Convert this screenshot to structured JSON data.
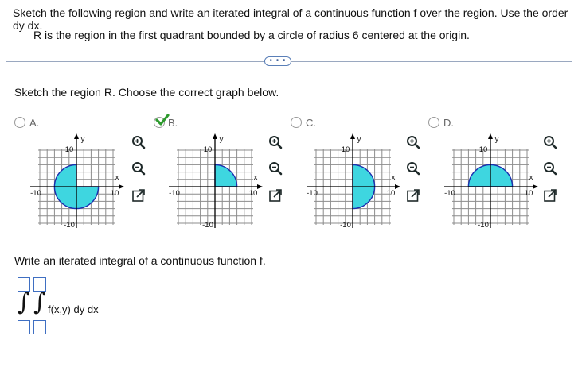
{
  "question": {
    "title": "Sketch the following region and write an iterated integral of a continuous function f over the region. Use the order dy dx.",
    "description": "R is the region in the first quadrant bounded by a circle of radius 6 centered at the origin.",
    "more_label": "• • •"
  },
  "part1": {
    "prompt": "Sketch the region R. Choose the correct graph below.",
    "selected_option": "B",
    "options": [
      {
        "letter": "A.",
        "region": "circle-with-quadrant-removed",
        "axis": {
          "y_label": "y",
          "x_label": "x",
          "ticks": [
            "10",
            "-10",
            "10",
            "-10"
          ]
        }
      },
      {
        "letter": "B.",
        "region": "first-quadrant-quarter-disk",
        "axis": {
          "y_label": "y",
          "x_label": "x",
          "ticks": [
            "10",
            "-10",
            "10",
            "-10"
          ]
        }
      },
      {
        "letter": "C.",
        "region": "right-half-disk",
        "axis": {
          "y_label": "y",
          "x_label": "x",
          "ticks": [
            "10",
            "-10",
            "10",
            "-10"
          ]
        }
      },
      {
        "letter": "D.",
        "region": "upper-half-disk",
        "axis": {
          "y_label": "y",
          "x_label": "x",
          "ticks": [
            "10",
            "-10",
            "10",
            "-10"
          ]
        }
      }
    ]
  },
  "part2": {
    "prompt": "Write an iterated integral of a continuous function f.",
    "integrand": "f(x,y) dy dx",
    "outer_upper": "",
    "outer_lower": "",
    "inner_upper": "",
    "inner_lower": ""
  },
  "colors": {
    "region_fill": "#3ed6e0",
    "region_stroke": "#1a2fb0",
    "check_green": "#2e9a2e",
    "box_blue": "#3f6fc2"
  },
  "icons": {
    "zoom_in": "zoom-in-icon",
    "zoom_out": "zoom-out-icon",
    "expand": "expand-icon"
  }
}
